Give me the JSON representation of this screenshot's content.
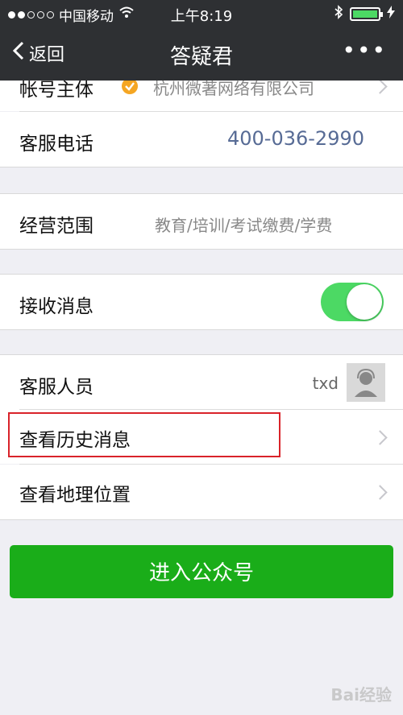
{
  "status": {
    "carrier": "中国移动",
    "time": "上午8:19"
  },
  "nav": {
    "back_label": "返回",
    "title": "答疑君"
  },
  "account": {
    "label": "帐号主体",
    "value": "杭州微著网络有限公司"
  },
  "service_phone": {
    "label": "客服电话",
    "value": "400-036-2990"
  },
  "business_scope": {
    "label": "经营范围",
    "value": "教育/培训/考试缴费/学费"
  },
  "receive_messages": {
    "label": "接收消息",
    "enabled": true
  },
  "agent": {
    "label": "客服人员",
    "name": "txd"
  },
  "history": {
    "label": "查看历史消息"
  },
  "location": {
    "label": "查看地理位置"
  },
  "enter_button": {
    "label": "进入公众号"
  },
  "watermark": {
    "text": "Bai经验"
  },
  "colors": {
    "green": "#1aad19",
    "toggle": "#4cd964",
    "link": "#576b95",
    "highlight": "#d9232a"
  }
}
